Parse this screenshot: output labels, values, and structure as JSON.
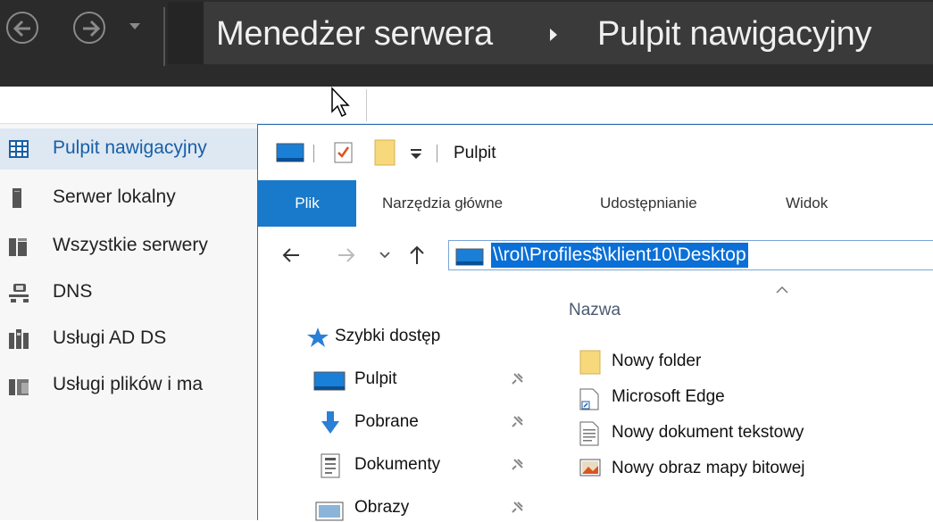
{
  "server_manager": {
    "breadcrumb": [
      "Menedżer serwera",
      "Pulpit nawigacyjny"
    ],
    "nav": [
      {
        "label": "Pulpit nawigacyjny",
        "icon": "dashboard-icon",
        "selected": true
      },
      {
        "label": "Serwer lokalny",
        "icon": "server-icon"
      },
      {
        "label": "Wszystkie serwery",
        "icon": "servers-icon"
      },
      {
        "label": "DNS",
        "icon": "dns-icon"
      },
      {
        "label": "Usługi AD DS",
        "icon": "ad-ds-icon"
      },
      {
        "label": "Usługi plików i ma",
        "icon": "file-services-icon"
      }
    ]
  },
  "explorer": {
    "title": "Pulpit",
    "tabs": [
      "Plik",
      "Narzędzia główne",
      "Udostępnianie",
      "Widok"
    ],
    "address": "\\\\rol\\Profiles$\\klient10\\Desktop",
    "quick_access": "Szybki dostęp",
    "nav_items": [
      {
        "label": "Pulpit",
        "icon": "desktop-icon"
      },
      {
        "label": "Pobrane",
        "icon": "download-icon"
      },
      {
        "label": "Dokumenty",
        "icon": "documents-icon"
      },
      {
        "label": "Obrazy",
        "icon": "pictures-icon"
      }
    ],
    "column_header": "Nazwa",
    "files": [
      {
        "name": "Nowy folder",
        "icon": "folder-icon"
      },
      {
        "name": "Microsoft Edge",
        "icon": "shortcut-icon"
      },
      {
        "name": "Nowy dokument tekstowy",
        "icon": "text-file-icon"
      },
      {
        "name": "Nowy obraz mapy bitowej",
        "icon": "bitmap-icon"
      }
    ]
  }
}
